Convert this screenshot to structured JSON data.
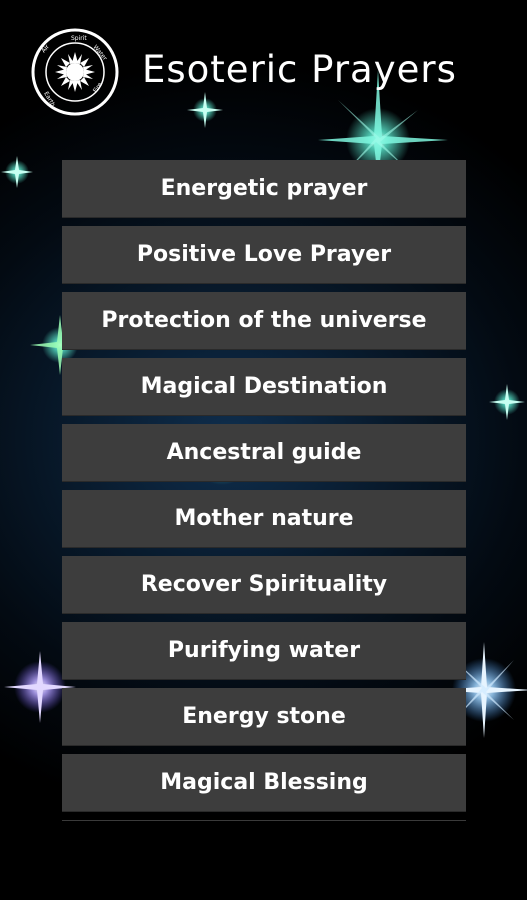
{
  "app": {
    "title": "Esoteric Prayers",
    "logo_icon": "zodiac-sun-icon",
    "logo_words": [
      "Spirit",
      "Water",
      "Fire",
      "Earth",
      "Air"
    ]
  },
  "colors": {
    "background": "#000000",
    "button_bg": "#3d3d3d",
    "button_text": "#ffffff",
    "sparkle_cyan": "#5ef2d6",
    "sparkle_violet": "#b9a8ff",
    "sparkle_blue": "#9fd4ff"
  },
  "menu": {
    "items": [
      {
        "label": "Energetic prayer"
      },
      {
        "label": "Positive Love Prayer"
      },
      {
        "label": "Protection of the universe"
      },
      {
        "label": "Magical Destination"
      },
      {
        "label": "Ancestral guide"
      },
      {
        "label": "Mother nature"
      },
      {
        "label": "Recover Spirituality"
      },
      {
        "label": "Purifying water"
      },
      {
        "label": "Energy stone"
      },
      {
        "label": "Magical Blessing"
      }
    ]
  }
}
